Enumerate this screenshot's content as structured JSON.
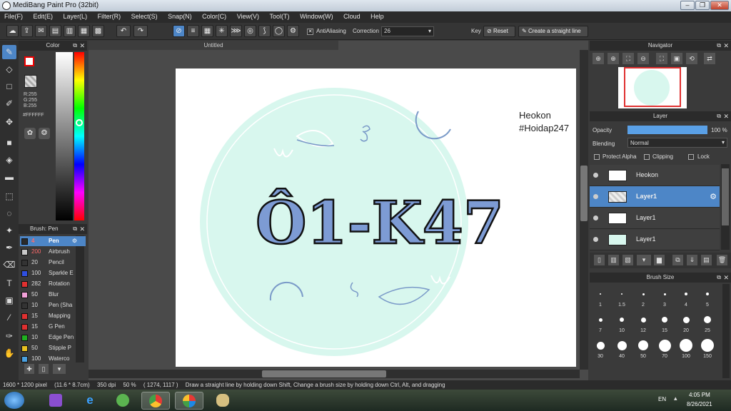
{
  "window": {
    "title": "MediBang Paint Pro (32bit)"
  },
  "menu": [
    "File(F)",
    "Edit(E)",
    "Layer(L)",
    "Filter(R)",
    "Select(S)",
    "Snap(N)",
    "Color(C)",
    "View(V)",
    "Tool(T)",
    "Window(W)",
    "Cloud",
    "Help"
  ],
  "toolbar": {
    "antialiasing_label": "AntiAliasing",
    "correction_label": "Correction",
    "correction_value": "26",
    "key_label": "Key",
    "reset_label": "Reset",
    "straight_line_label": "Create a straight line"
  },
  "color_panel": {
    "title": "Color",
    "r": "R:255",
    "g": "G:255",
    "b": "B:255",
    "hex": "#FFFFFF",
    "fg_color": "#ffffff",
    "bg_color": "#000000"
  },
  "brush_panel": {
    "title": "Brush: Pen",
    "items": [
      {
        "size": "4",
        "name": "Pen",
        "color": "#2a2a2a"
      },
      {
        "size": "200",
        "name": "Airbrush",
        "color": "#c8c8c8"
      },
      {
        "size": "20",
        "name": "Pencil",
        "color": "#333333"
      },
      {
        "size": "100",
        "name": "Sparkle E",
        "color": "#2f4fe0"
      },
      {
        "size": "282",
        "name": "Rotation",
        "color": "#e03030"
      },
      {
        "size": "50",
        "name": "Blur",
        "color": "#f2a0d8"
      },
      {
        "size": "10",
        "name": "Pen (Sha",
        "color": "#333333"
      },
      {
        "size": "15",
        "name": "Mapping",
        "color": "#e03030"
      },
      {
        "size": "15",
        "name": "G Pen",
        "color": "#e03030"
      },
      {
        "size": "10",
        "name": "Edge Pen",
        "color": "#20b020"
      },
      {
        "size": "50",
        "name": "Stipple P",
        "color": "#e8c020"
      },
      {
        "size": "100",
        "name": "Waterco",
        "color": "#4aa0e0"
      }
    ]
  },
  "document": {
    "tab": "Untitled",
    "text_line1": "Heokon",
    "text_line2": "#Hoidap247",
    "artwork_text": "Ô1-K47"
  },
  "navigator": {
    "title": "Navigator"
  },
  "layer_panel": {
    "title": "Layer",
    "opacity_label": "Opacity",
    "opacity_value": "100 %",
    "opacity_level": 1.0,
    "blending_label": "Blending",
    "blending_value": "Normal",
    "protect_alpha": "Protect Alpha",
    "clipping": "Clipping",
    "lock": "Lock",
    "layers": [
      {
        "name": "Heokon",
        "selected": false
      },
      {
        "name": "Layer1",
        "selected": true
      },
      {
        "name": "Layer1",
        "selected": false
      },
      {
        "name": "Layer1",
        "selected": false
      }
    ]
  },
  "brush_size_panel": {
    "title": "Brush Size",
    "sizes": [
      "1",
      "1.5",
      "2",
      "3",
      "4",
      "5",
      "7",
      "10",
      "12",
      "15",
      "20",
      "25",
      "30",
      "40",
      "50",
      "70",
      "100",
      "150"
    ]
  },
  "status": {
    "size": "1600 * 1200 pixel",
    "physical": "(11.6 * 8.7cm)",
    "dpi": "350 dpi",
    "zoom": "50 %",
    "coords": "( 1274, 1117 )",
    "hint": "Draw a straight line by holding down Shift, Change a brush size by holding down Ctrl, Alt, and dragging"
  },
  "taskbar": {
    "lang": "EN",
    "time": "4:05 PM",
    "date": "8/26/2021"
  }
}
